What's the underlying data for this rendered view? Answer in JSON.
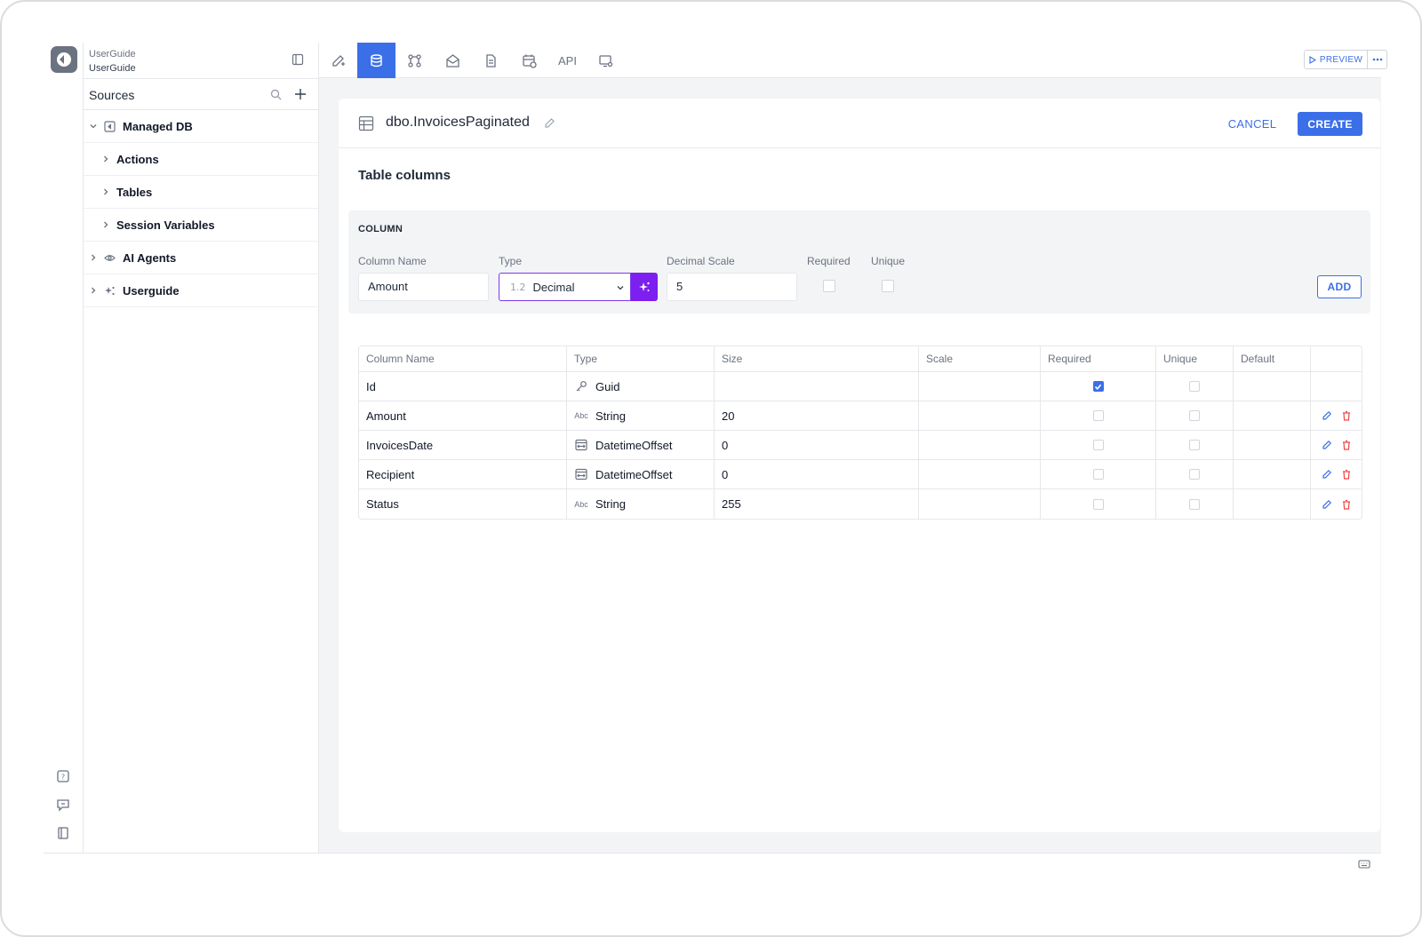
{
  "app": {
    "org_name": "UserGuide",
    "app_name": "UserGuide"
  },
  "sidebar": {
    "title": "Sources",
    "tree": [
      {
        "label": "Managed DB",
        "level": 0,
        "expanded": true,
        "icon": "database-arrow-icon"
      },
      {
        "label": "Actions",
        "level": 1,
        "expanded": false
      },
      {
        "label": "Tables",
        "level": 1,
        "expanded": false
      },
      {
        "label": "Session Variables",
        "level": 1,
        "expanded": false
      },
      {
        "label": "AI Agents",
        "level": 0,
        "expanded": false,
        "icon": "eye-icon"
      },
      {
        "label": "Userguide",
        "level": 0,
        "expanded": false,
        "icon": "sparkle-icon"
      }
    ]
  },
  "toolbar": {
    "items": [
      "design-icon",
      "database-icon",
      "workflow-icon",
      "mail-icon",
      "document-icon",
      "calendar-icon",
      "API",
      "deploy-icon"
    ],
    "api_label": "API",
    "active_index": 1,
    "preview_label": "PREVIEW"
  },
  "editor": {
    "table_name": "dbo.InvoicesPaginated",
    "cancel_label": "CANCEL",
    "create_label": "CREATE",
    "section_title": "Table columns"
  },
  "column_form": {
    "panel_label": "COLUMN",
    "name_label": "Column Name",
    "name_value": "Amount",
    "type_label": "Type",
    "type_value": "Decimal",
    "type_icon_text": "1.2",
    "scale_label": "Decimal Scale",
    "scale_value": "5",
    "required_label": "Required",
    "unique_label": "Unique",
    "required_checked": false,
    "unique_checked": false,
    "add_label": "ADD"
  },
  "columns_table": {
    "headers": [
      "Column Name",
      "Type",
      "Size",
      "Scale",
      "Required",
      "Unique",
      "Default",
      ""
    ],
    "rows": [
      {
        "name": "Id",
        "type": "Guid",
        "type_icon": "key-icon",
        "size": "",
        "scale": "",
        "required": true,
        "unique": false,
        "default": "",
        "actions": false
      },
      {
        "name": "Amount",
        "type": "String",
        "type_icon": "abc-icon",
        "size": "20",
        "scale": "",
        "required": false,
        "unique": false,
        "default": "",
        "actions": true
      },
      {
        "name": "InvoicesDate",
        "type": "DatetimeOffset",
        "type_icon": "datetime-icon",
        "size": "0",
        "scale": "",
        "required": false,
        "unique": false,
        "default": "",
        "actions": true
      },
      {
        "name": "Recipient",
        "type": "DatetimeOffset",
        "type_icon": "datetime-icon",
        "size": "0",
        "scale": "",
        "required": false,
        "unique": false,
        "default": "",
        "actions": true
      },
      {
        "name": "Status",
        "type": "String",
        "type_icon": "abc-icon",
        "size": "255",
        "scale": "",
        "required": false,
        "unique": false,
        "default": "",
        "actions": true
      }
    ],
    "abc_text": "Abc"
  },
  "colors": {
    "accent": "#3b6fe8",
    "ai_purple": "#7c1ff0",
    "danger": "#ef4444"
  }
}
